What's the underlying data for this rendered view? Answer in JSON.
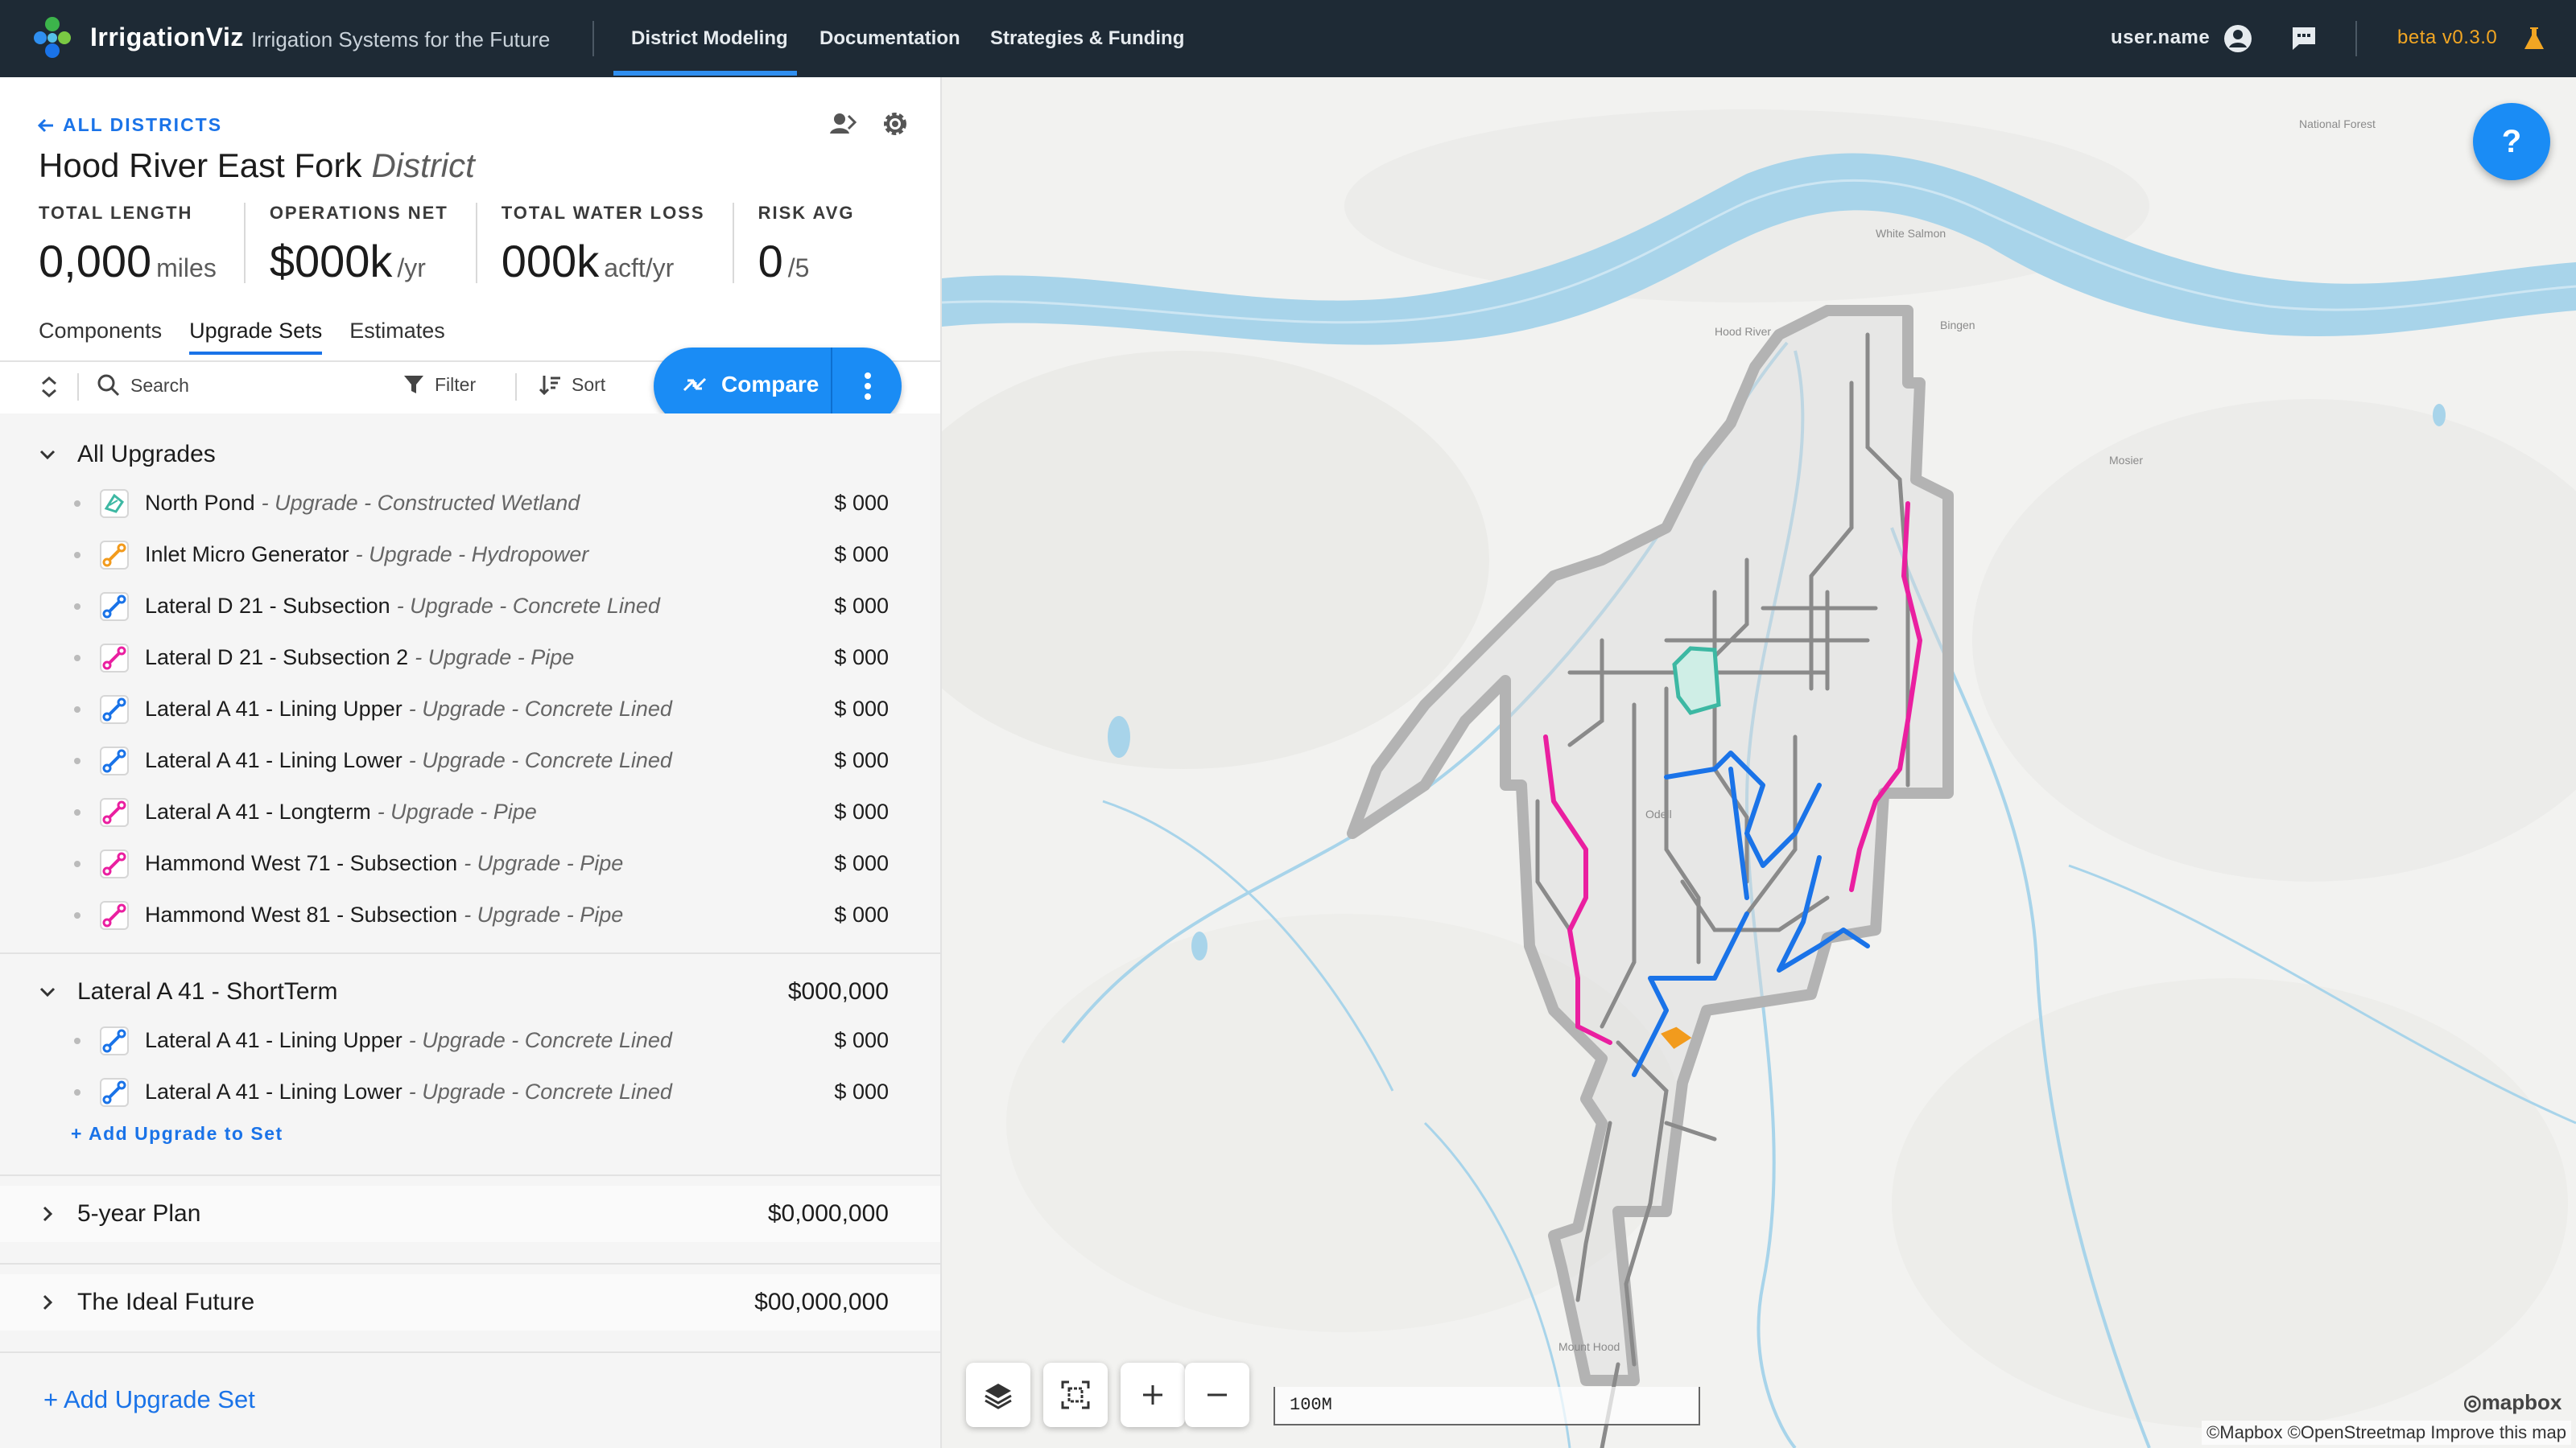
{
  "app": {
    "brand": "IrrigationViz",
    "tagline": "Irrigation Systems for the Future",
    "nav": [
      "District Modeling",
      "Documentation",
      "Strategies & Funding"
    ],
    "user_name": "user.name",
    "version": "beta v0.3.0",
    "icons": [
      "account-icon",
      "chat-icon",
      "flask-icon"
    ]
  },
  "district": {
    "back_label": "ALL DISTRICTS",
    "name": "Hood River East Fork",
    "type": "District",
    "stats": [
      {
        "label": "TOTAL LENGTH",
        "value": "0,000",
        "unit": "miles"
      },
      {
        "label": "OPERATIONS NET",
        "value": "$000k",
        "unit": "/yr"
      },
      {
        "label": "TOTAL WATER LOSS",
        "value": "000k",
        "unit": "acft/yr"
      },
      {
        "label": "RISK AVG",
        "value": "0",
        "unit": "/5"
      }
    ]
  },
  "tabs": [
    "Components",
    "Upgrade Sets",
    "Estimates"
  ],
  "active_tab": "Upgrade Sets",
  "toolbar": {
    "search_placeholder": "Search",
    "filter_label": "Filter",
    "sort_label": "Sort",
    "compare_label": "Compare"
  },
  "groups": [
    {
      "title": "All Upgrades",
      "cost": "",
      "expanded": true,
      "items": [
        {
          "name": "North Pond",
          "detail": "- Upgrade - Constructed Wetland",
          "cost": "$ 000",
          "icon": "wetland-icon",
          "color": "#3db8a3"
        },
        {
          "name": "Inlet Micro Generator",
          "detail": "- Upgrade - Hydropower",
          "cost": "$ 000",
          "icon": "hydropower-icon",
          "color": "#f29b1d"
        },
        {
          "name": "Lateral D 21 - Subsection",
          "detail": "- Upgrade - Concrete Lined",
          "cost": "$ 000",
          "icon": "concrete-lined-icon",
          "color": "#1a73e8"
        },
        {
          "name": "Lateral D 21 - Subsection 2",
          "detail": "- Upgrade - Pipe",
          "cost": "$ 000",
          "icon": "pipe-icon",
          "color": "#ea1fa0"
        },
        {
          "name": "Lateral A 41 - Lining Upper",
          "detail": "- Upgrade - Concrete Lined",
          "cost": "$ 000",
          "icon": "concrete-lined-icon",
          "color": "#1a73e8"
        },
        {
          "name": "Lateral A 41 - Lining Lower",
          "detail": "- Upgrade - Concrete Lined",
          "cost": "$ 000",
          "icon": "concrete-lined-icon",
          "color": "#1a73e8"
        },
        {
          "name": "Lateral A 41 - Longterm",
          "detail": "- Upgrade - Pipe",
          "cost": "$ 000",
          "icon": "pipe-icon",
          "color": "#ea1fa0"
        },
        {
          "name": "Hammond West 71 - Subsection",
          "detail": "- Upgrade - Pipe",
          "cost": "$ 000",
          "icon": "pipe-icon",
          "color": "#ea1fa0"
        },
        {
          "name": "Hammond West 81 - Subsection",
          "detail": "- Upgrade - Pipe",
          "cost": "$ 000",
          "icon": "pipe-icon",
          "color": "#ea1fa0"
        }
      ]
    },
    {
      "title": "Lateral A 41 - ShortTerm",
      "cost": "$000,000",
      "expanded": true,
      "items": [
        {
          "name": "Lateral A 41 - Lining Upper",
          "detail": "- Upgrade - Concrete Lined",
          "cost": "$ 000",
          "icon": "concrete-lined-icon",
          "color": "#1a73e8"
        },
        {
          "name": "Lateral A 41 - Lining Lower",
          "detail": "- Upgrade - Concrete Lined",
          "cost": "$ 000",
          "icon": "concrete-lined-icon",
          "color": "#1a73e8"
        }
      ],
      "add_label": "+ Add Upgrade to Set"
    },
    {
      "title": "5-year Plan",
      "cost": "$0,000,000",
      "expanded": false,
      "items": []
    },
    {
      "title": "The Ideal Future",
      "cost": "$00,000,000",
      "expanded": false,
      "items": []
    }
  ],
  "add_set_label": "+ Add Upgrade Set",
  "map": {
    "help_label": "?",
    "scale_label": "100M",
    "attribution": "©Mapbox ©OpenStreetmap Improve this map",
    "logo": "mapbox",
    "place_labels": [
      "Hood River",
      "White Salmon",
      "Bingen",
      "Mosier",
      "Odell",
      "Mount Hood",
      "National Forest"
    ],
    "colors": {
      "river": "#a8d4ea",
      "boundary": "#b3b3b3",
      "pipe": "#ea1fa0",
      "concrete": "#1a73e8",
      "wetland": "#3db8a3",
      "hydro": "#f29b1d",
      "canal": "#8a8a8a"
    }
  }
}
